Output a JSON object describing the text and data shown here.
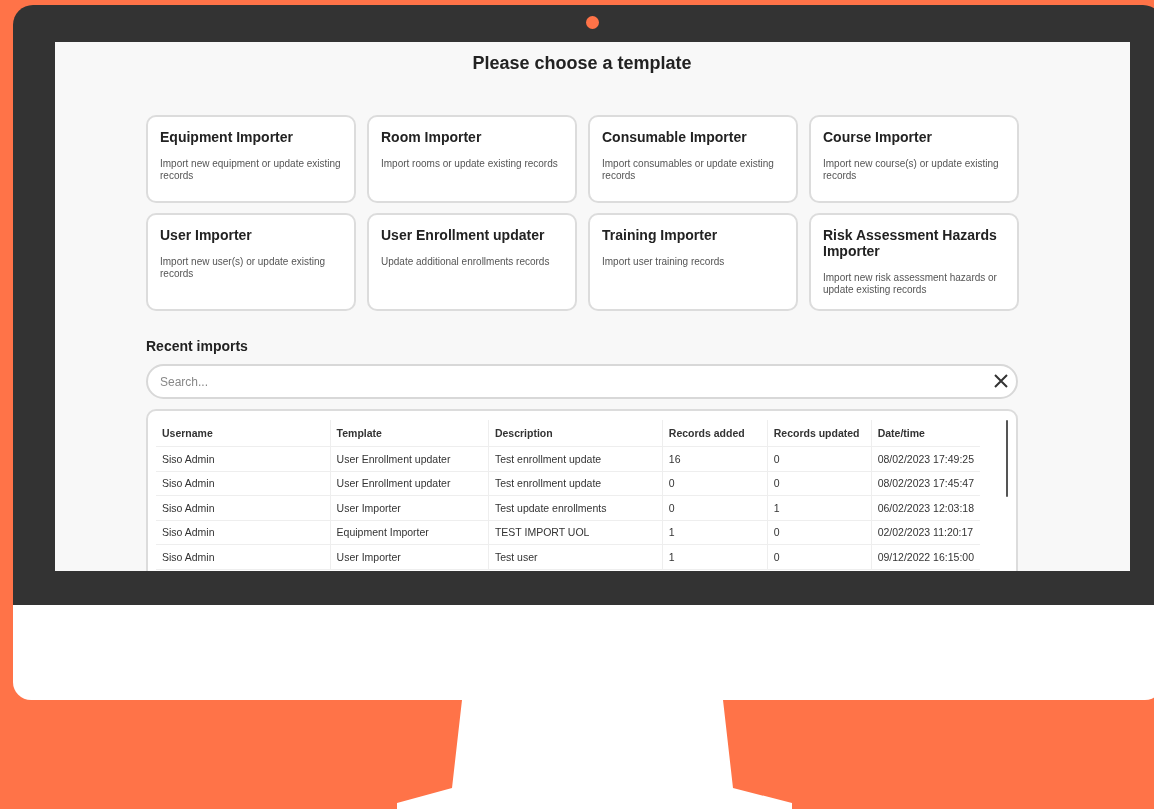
{
  "page": {
    "title": "Please choose a template"
  },
  "templates": [
    {
      "title": "Equipment Importer",
      "description": "Import new equipment or update existing records"
    },
    {
      "title": "Room Importer",
      "description": "Import rooms or update existing records"
    },
    {
      "title": "Consumable Importer",
      "description": "Import consumables or update existing records"
    },
    {
      "title": "Course Importer",
      "description": "Import new course(s) or update existing records"
    },
    {
      "title": "User Importer",
      "description": "Import new user(s) or update existing records"
    },
    {
      "title": "User Enrollment updater",
      "description": "Update additional enrollments records"
    },
    {
      "title": "Training Importer",
      "description": "Import user training records"
    },
    {
      "title": "Risk Assessment Hazards Importer",
      "description": "Import new risk assessment hazards or update existing records"
    }
  ],
  "recent_imports": {
    "heading": "Recent imports",
    "search": {
      "placeholder": "Search..."
    },
    "table": {
      "columns": [
        "Username",
        "Template",
        "Description",
        "Records added",
        "Records updated",
        "Date/time"
      ],
      "rows": [
        [
          "Siso Admin",
          "User Enrollment updater",
          "Test enrollment update",
          "16",
          "0",
          "08/02/2023 17:49:25"
        ],
        [
          "Siso Admin",
          "User Enrollment updater",
          "Test enrollment update",
          "0",
          "0",
          "08/02/2023 17:45:47"
        ],
        [
          "Siso Admin",
          "User Importer",
          "Test update enrollments",
          "0",
          "1",
          "06/02/2023 12:03:18"
        ],
        [
          "Siso Admin",
          "Equipment Importer",
          "TEST IMPORT UOL",
          "1",
          "0",
          "02/02/2023 11:20:17"
        ],
        [
          "Siso Admin",
          "User Importer",
          "Test user",
          "1",
          "0",
          "09/12/2022 16:15:00"
        ]
      ]
    }
  }
}
